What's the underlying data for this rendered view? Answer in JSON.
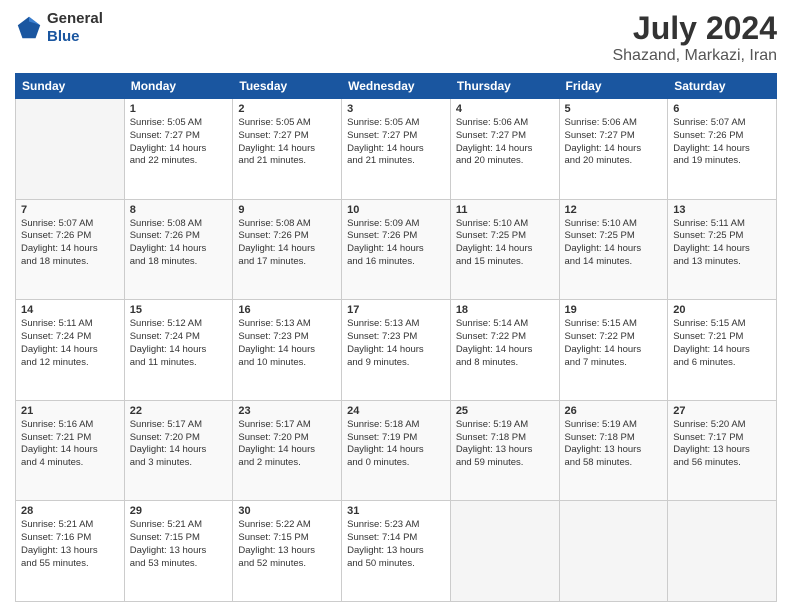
{
  "logo": {
    "general": "General",
    "blue": "Blue"
  },
  "title": "July 2024",
  "subtitle": "Shazand, Markazi, Iran",
  "days": [
    "Sunday",
    "Monday",
    "Tuesday",
    "Wednesday",
    "Thursday",
    "Friday",
    "Saturday"
  ],
  "weeks": [
    [
      {
        "num": "",
        "empty": true
      },
      {
        "num": "1",
        "line1": "Sunrise: 5:05 AM",
        "line2": "Sunset: 7:27 PM",
        "line3": "Daylight: 14 hours",
        "line4": "and 22 minutes."
      },
      {
        "num": "2",
        "line1": "Sunrise: 5:05 AM",
        "line2": "Sunset: 7:27 PM",
        "line3": "Daylight: 14 hours",
        "line4": "and 21 minutes."
      },
      {
        "num": "3",
        "line1": "Sunrise: 5:05 AM",
        "line2": "Sunset: 7:27 PM",
        "line3": "Daylight: 14 hours",
        "line4": "and 21 minutes."
      },
      {
        "num": "4",
        "line1": "Sunrise: 5:06 AM",
        "line2": "Sunset: 7:27 PM",
        "line3": "Daylight: 14 hours",
        "line4": "and 20 minutes."
      },
      {
        "num": "5",
        "line1": "Sunrise: 5:06 AM",
        "line2": "Sunset: 7:27 PM",
        "line3": "Daylight: 14 hours",
        "line4": "and 20 minutes."
      },
      {
        "num": "6",
        "line1": "Sunrise: 5:07 AM",
        "line2": "Sunset: 7:26 PM",
        "line3": "Daylight: 14 hours",
        "line4": "and 19 minutes."
      }
    ],
    [
      {
        "num": "7",
        "line1": "Sunrise: 5:07 AM",
        "line2": "Sunset: 7:26 PM",
        "line3": "Daylight: 14 hours",
        "line4": "and 18 minutes."
      },
      {
        "num": "8",
        "line1": "Sunrise: 5:08 AM",
        "line2": "Sunset: 7:26 PM",
        "line3": "Daylight: 14 hours",
        "line4": "and 18 minutes."
      },
      {
        "num": "9",
        "line1": "Sunrise: 5:08 AM",
        "line2": "Sunset: 7:26 PM",
        "line3": "Daylight: 14 hours",
        "line4": "and 17 minutes."
      },
      {
        "num": "10",
        "line1": "Sunrise: 5:09 AM",
        "line2": "Sunset: 7:26 PM",
        "line3": "Daylight: 14 hours",
        "line4": "and 16 minutes."
      },
      {
        "num": "11",
        "line1": "Sunrise: 5:10 AM",
        "line2": "Sunset: 7:25 PM",
        "line3": "Daylight: 14 hours",
        "line4": "and 15 minutes."
      },
      {
        "num": "12",
        "line1": "Sunrise: 5:10 AM",
        "line2": "Sunset: 7:25 PM",
        "line3": "Daylight: 14 hours",
        "line4": "and 14 minutes."
      },
      {
        "num": "13",
        "line1": "Sunrise: 5:11 AM",
        "line2": "Sunset: 7:25 PM",
        "line3": "Daylight: 14 hours",
        "line4": "and 13 minutes."
      }
    ],
    [
      {
        "num": "14",
        "line1": "Sunrise: 5:11 AM",
        "line2": "Sunset: 7:24 PM",
        "line3": "Daylight: 14 hours",
        "line4": "and 12 minutes."
      },
      {
        "num": "15",
        "line1": "Sunrise: 5:12 AM",
        "line2": "Sunset: 7:24 PM",
        "line3": "Daylight: 14 hours",
        "line4": "and 11 minutes."
      },
      {
        "num": "16",
        "line1": "Sunrise: 5:13 AM",
        "line2": "Sunset: 7:23 PM",
        "line3": "Daylight: 14 hours",
        "line4": "and 10 minutes."
      },
      {
        "num": "17",
        "line1": "Sunrise: 5:13 AM",
        "line2": "Sunset: 7:23 PM",
        "line3": "Daylight: 14 hours",
        "line4": "and 9 minutes."
      },
      {
        "num": "18",
        "line1": "Sunrise: 5:14 AM",
        "line2": "Sunset: 7:22 PM",
        "line3": "Daylight: 14 hours",
        "line4": "and 8 minutes."
      },
      {
        "num": "19",
        "line1": "Sunrise: 5:15 AM",
        "line2": "Sunset: 7:22 PM",
        "line3": "Daylight: 14 hours",
        "line4": "and 7 minutes."
      },
      {
        "num": "20",
        "line1": "Sunrise: 5:15 AM",
        "line2": "Sunset: 7:21 PM",
        "line3": "Daylight: 14 hours",
        "line4": "and 6 minutes."
      }
    ],
    [
      {
        "num": "21",
        "line1": "Sunrise: 5:16 AM",
        "line2": "Sunset: 7:21 PM",
        "line3": "Daylight: 14 hours",
        "line4": "and 4 minutes."
      },
      {
        "num": "22",
        "line1": "Sunrise: 5:17 AM",
        "line2": "Sunset: 7:20 PM",
        "line3": "Daylight: 14 hours",
        "line4": "and 3 minutes."
      },
      {
        "num": "23",
        "line1": "Sunrise: 5:17 AM",
        "line2": "Sunset: 7:20 PM",
        "line3": "Daylight: 14 hours",
        "line4": "and 2 minutes."
      },
      {
        "num": "24",
        "line1": "Sunrise: 5:18 AM",
        "line2": "Sunset: 7:19 PM",
        "line3": "Daylight: 14 hours",
        "line4": "and 0 minutes."
      },
      {
        "num": "25",
        "line1": "Sunrise: 5:19 AM",
        "line2": "Sunset: 7:18 PM",
        "line3": "Daylight: 13 hours",
        "line4": "and 59 minutes."
      },
      {
        "num": "26",
        "line1": "Sunrise: 5:19 AM",
        "line2": "Sunset: 7:18 PM",
        "line3": "Daylight: 13 hours",
        "line4": "and 58 minutes."
      },
      {
        "num": "27",
        "line1": "Sunrise: 5:20 AM",
        "line2": "Sunset: 7:17 PM",
        "line3": "Daylight: 13 hours",
        "line4": "and 56 minutes."
      }
    ],
    [
      {
        "num": "28",
        "line1": "Sunrise: 5:21 AM",
        "line2": "Sunset: 7:16 PM",
        "line3": "Daylight: 13 hours",
        "line4": "and 55 minutes."
      },
      {
        "num": "29",
        "line1": "Sunrise: 5:21 AM",
        "line2": "Sunset: 7:15 PM",
        "line3": "Daylight: 13 hours",
        "line4": "and 53 minutes."
      },
      {
        "num": "30",
        "line1": "Sunrise: 5:22 AM",
        "line2": "Sunset: 7:15 PM",
        "line3": "Daylight: 13 hours",
        "line4": "and 52 minutes."
      },
      {
        "num": "31",
        "line1": "Sunrise: 5:23 AM",
        "line2": "Sunset: 7:14 PM",
        "line3": "Daylight: 13 hours",
        "line4": "and 50 minutes."
      },
      {
        "num": "",
        "empty": true
      },
      {
        "num": "",
        "empty": true
      },
      {
        "num": "",
        "empty": true
      }
    ]
  ]
}
